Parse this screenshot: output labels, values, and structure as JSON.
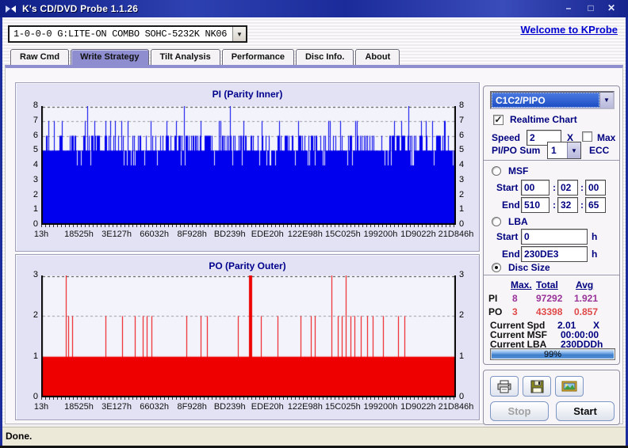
{
  "titlebar": {
    "title": "K's CD/DVD Probe 1.1.26",
    "minimize": "–",
    "maximize": "□",
    "close": "✕"
  },
  "header": {
    "drive": "1-0-0-0 G:LITE-ON COMBO SOHC-5232K NK06",
    "dropdown_arrow": "▼",
    "welcome_link": "Welcome to KProbe"
  },
  "tabs": [
    {
      "label": "Raw Cmd",
      "active": false
    },
    {
      "label": "Write Strategy",
      "active": true
    },
    {
      "label": "Tilt Analysis",
      "active": false
    },
    {
      "label": "Performance",
      "active": false
    },
    {
      "label": "Disc Info.",
      "active": false
    },
    {
      "label": "About",
      "active": false
    }
  ],
  "chart_data": [
    {
      "type": "bar",
      "title": "PI (Parity Inner)",
      "ylim": [
        0,
        8
      ],
      "yticks": [
        0,
        1,
        2,
        3,
        4,
        5,
        6,
        7,
        8
      ],
      "x_tick_labels": [
        "13h",
        "18525h",
        "3E127h",
        "66032h",
        "8F928h",
        "BD239h",
        "EDE20h",
        "122E98h",
        "15C025h",
        "199200h",
        "1D9022h",
        "21D846h"
      ],
      "color": "#0000ee",
      "grid": "dashed-horizontal",
      "bar_base_level": 5,
      "distribution": {
        "4": 0.08,
        "5": 0.52,
        "6": 0.33,
        "7": 0.07
      },
      "spikes_level8_x_fraction": [
        0.11,
        0.345,
        0.455,
        0.885
      ],
      "max": 8,
      "total": 97292,
      "avg": 1.921,
      "seed": 20
    },
    {
      "type": "bar",
      "title": "PO (Parity Outer)",
      "ylim": [
        0,
        3
      ],
      "yticks": [
        0,
        1,
        2,
        3
      ],
      "x_tick_labels": [
        "13h",
        "18525h",
        "3E127h",
        "66032h",
        "8F928h",
        "BD239h",
        "EDE20h",
        "122E98h",
        "15C025h",
        "199200h",
        "1D9022h",
        "21D846h"
      ],
      "color": "#ee0000",
      "grid": "dashed-horizontal",
      "bar_base_level": 1,
      "spikes_level2_x_fraction": [
        0.065,
        0.075,
        0.155,
        0.195,
        0.225,
        0.245,
        0.255,
        0.265,
        0.35,
        0.385,
        0.4,
        0.475,
        0.53,
        0.57,
        0.625,
        0.65,
        0.66,
        0.715,
        0.725,
        0.745,
        0.755,
        0.77,
        0.785,
        0.8,
        0.825,
        0.86,
        0.875
      ],
      "spikes_level3_x_fraction": [
        0.06,
        0.5,
        0.7,
        0.735
      ],
      "thick_spike_x_fraction": 0.5,
      "max": 3,
      "total": 43398,
      "avg": 0.857,
      "seed": 7
    }
  ],
  "controls": {
    "mode_select": "C1C2/PIPO",
    "realtime_chart_label": "Realtime Chart",
    "realtime_checked": true,
    "check_glyph": "✓",
    "speed_label": "Speed",
    "speed_value": "2",
    "speed_unit": "X",
    "max_label": "Max",
    "max_checked": false,
    "pipo_sum_label": "PI/PO Sum",
    "pipo_sum_value": "1",
    "ecc_label": "ECC"
  },
  "range": {
    "msf_label": "MSF",
    "lba_label": "LBA",
    "disc_size_label": "Disc Size",
    "start_label": "Start",
    "end_label": "End",
    "msf_start": [
      "00",
      "02",
      "00"
    ],
    "msf_end": [
      "510",
      "32",
      "65"
    ],
    "lba_start": "0",
    "lba_end": "230DE3",
    "hex_suffix": "h",
    "selected": "disc_size"
  },
  "stats": {
    "headers": {
      "max": "Max.",
      "total": "Total",
      "avg": "Avg"
    },
    "pi": {
      "label": "PI",
      "max": "8",
      "total": "97292",
      "avg": "1.921"
    },
    "po": {
      "label": "PO",
      "max": "3",
      "total": "43398",
      "avg": "0.857"
    },
    "current_spd_label": "Current Spd",
    "current_spd": "2.01",
    "current_spd_unit": "X",
    "current_msf_label": "Current MSF",
    "current_msf": "00:00:00",
    "current_lba_label": "Current LBA",
    "current_lba": "230DDDh",
    "progress_percent": 99,
    "progress_label": "99%"
  },
  "actions": {
    "stop_label": "Stop",
    "start_label": "Start",
    "stop_enabled": false
  },
  "statusbar": {
    "text": "Done."
  },
  "colors": {
    "accent_purple": "#8d8dd0",
    "navy_label": "#000080",
    "pi_bar": "#0000ee",
    "po_bar": "#ee0000",
    "pi_stat": "#993399",
    "po_stat": "#e04848",
    "link": "#0000cf",
    "select_highlight": "#1d4fc4",
    "statusbar_bg": "#ece9d8"
  }
}
